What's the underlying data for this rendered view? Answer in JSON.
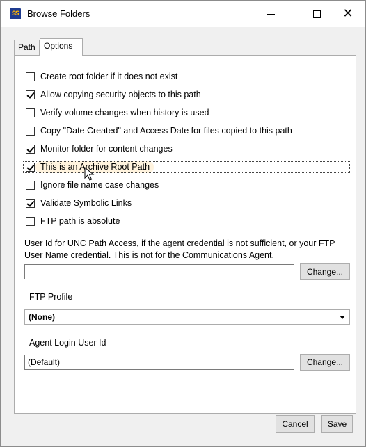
{
  "window": {
    "title": "Browse Folders",
    "icon_text": "SS",
    "minimize_glyph": "minimize-icon",
    "maximize_glyph": "maximize-icon",
    "close_glyph": "✕"
  },
  "tabs": [
    {
      "label": "Path"
    },
    {
      "label": "Options"
    }
  ],
  "options": [
    {
      "label": "Create root folder if it does not exist",
      "checked": false
    },
    {
      "label": "Allow copying security objects to this path",
      "checked": true
    },
    {
      "label": "Verify volume changes when history is used",
      "checked": false
    },
    {
      "label": "Copy \"Date Created\" and Access Date for files copied to this path",
      "checked": false
    },
    {
      "label": "Monitor folder for content changes",
      "checked": true
    },
    {
      "label": "This is an Archive Root Path",
      "checked": true
    },
    {
      "label": "Ignore file name case changes",
      "checked": false
    },
    {
      "label": "Validate Symbolic Links",
      "checked": true
    },
    {
      "label": "FTP path is absolute",
      "checked": false
    }
  ],
  "unc": {
    "description": "User Id for UNC Path Access, if the agent credential is not sufficient, or your FTP User Name credential. This is not for the Communications Agent.",
    "value": "",
    "change_label": "Change..."
  },
  "ftp_profile": {
    "label": "FTP Profile",
    "selected": "(None)"
  },
  "agent_login": {
    "label": "Agent Login User Id",
    "value": "(Default)",
    "change_label": "Change..."
  },
  "footer": {
    "cancel_label": "Cancel",
    "save_label": "Save"
  }
}
